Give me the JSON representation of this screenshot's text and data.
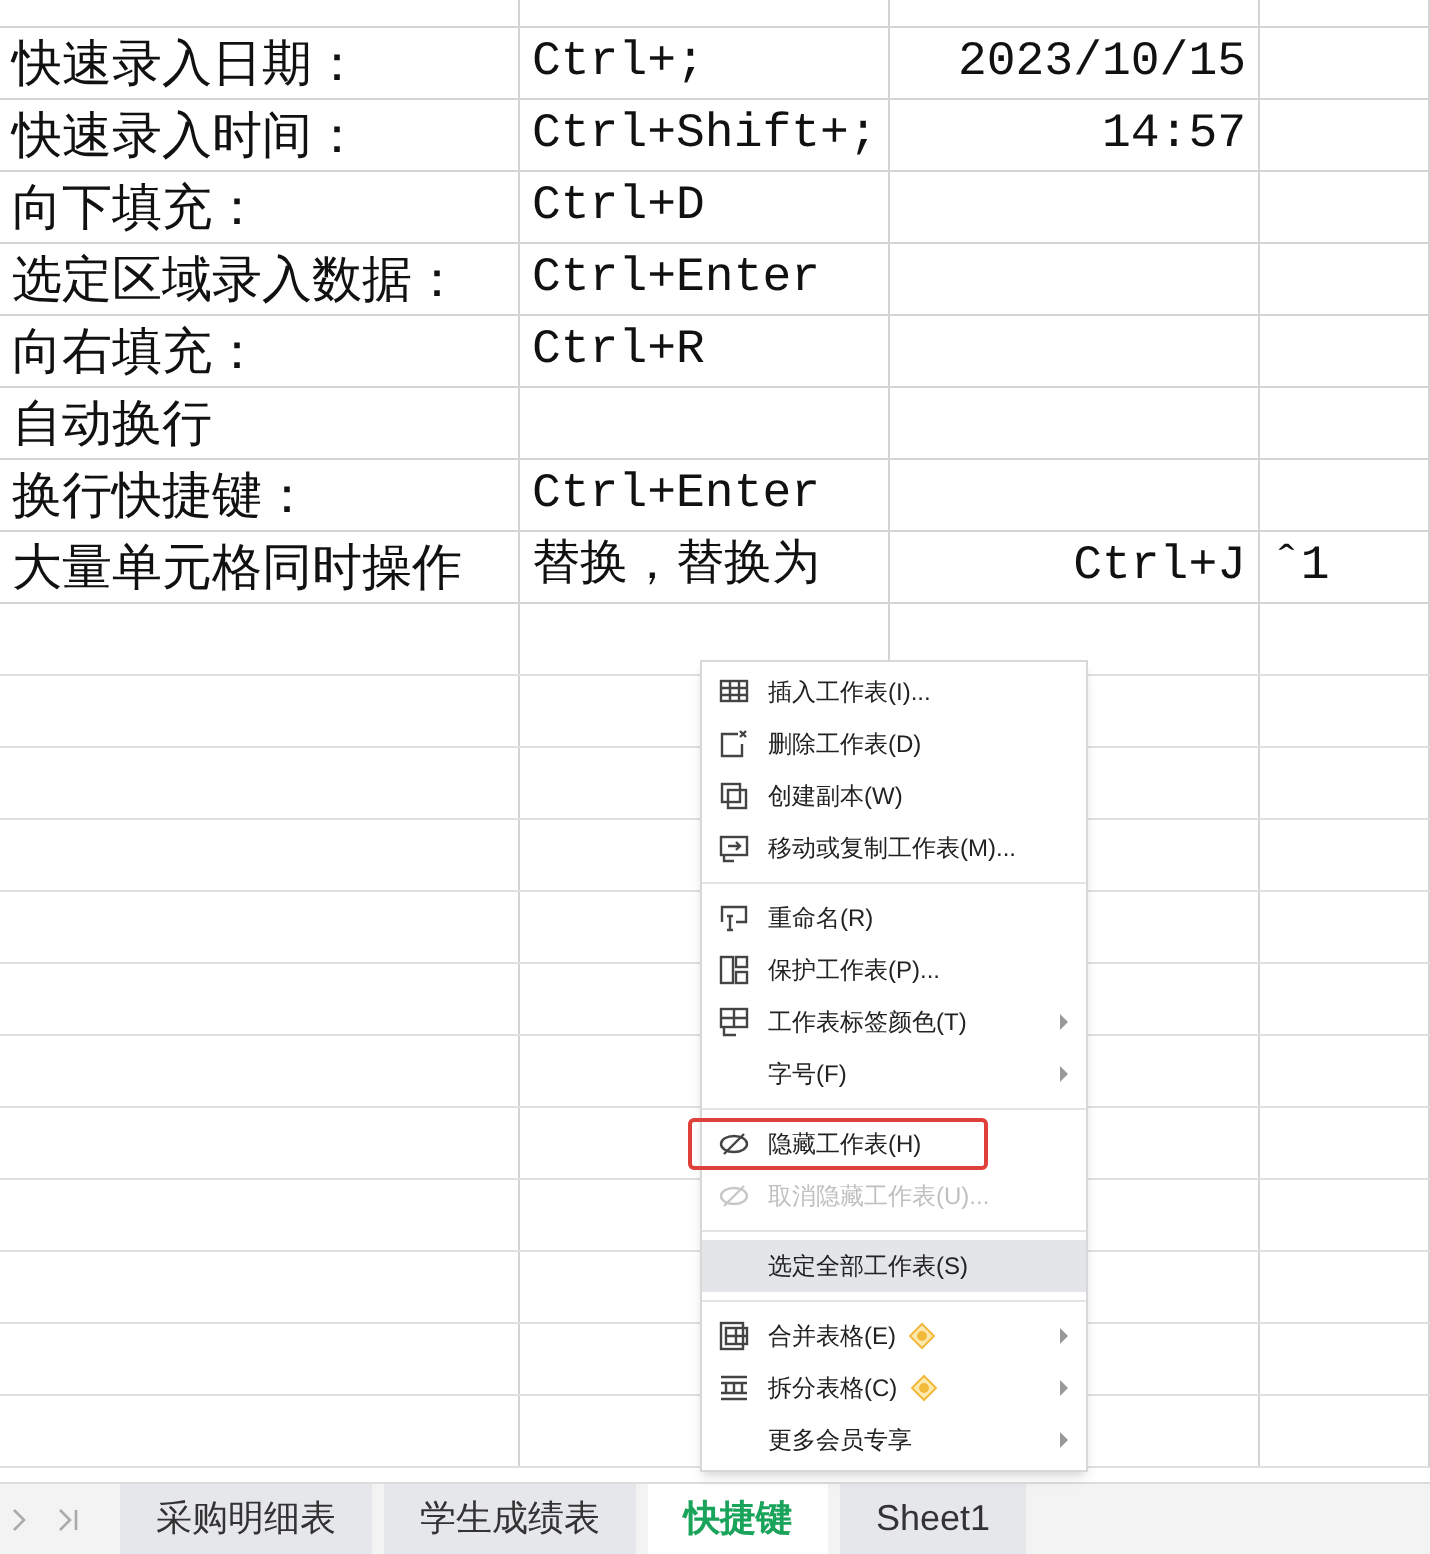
{
  "sheet": {
    "rows": [
      {
        "cells": [
          "快速录入日期：",
          "Ctrl+;",
          "2023/10/15",
          ""
        ]
      },
      {
        "cells": [
          "快速录入时间：",
          "Ctrl+Shift+;",
          "14:57",
          ""
        ]
      },
      {
        "cells": [
          "向下填充：",
          "Ctrl+D",
          "",
          ""
        ]
      },
      {
        "cells": [
          "选定区域录入数据：",
          "Ctrl+Enter",
          "",
          ""
        ]
      },
      {
        "cells": [
          "向右填充：",
          "Ctrl+R",
          "",
          ""
        ]
      },
      {
        "cells": [
          "自动换行",
          "",
          "",
          ""
        ]
      },
      {
        "cells": [
          "换行快捷键：",
          "Ctrl+Enter",
          "",
          ""
        ]
      },
      {
        "cells": [
          "大量单元格同时操作",
          "替换，替换为",
          "Ctrl+J",
          "ˆ1"
        ]
      }
    ]
  },
  "context_menu": {
    "items": [
      {
        "kind": "item",
        "label": "插入工作表(I)...",
        "disabled": false,
        "submenu": false,
        "premium": false,
        "highlighted": false,
        "outlined": false
      },
      {
        "kind": "item",
        "label": "删除工作表(D)",
        "disabled": false,
        "submenu": false,
        "premium": false,
        "highlighted": false,
        "outlined": false
      },
      {
        "kind": "item",
        "label": "创建副本(W)",
        "disabled": false,
        "submenu": false,
        "premium": false,
        "highlighted": false,
        "outlined": false
      },
      {
        "kind": "item",
        "label": "移动或复制工作表(M)...",
        "disabled": false,
        "submenu": false,
        "premium": false,
        "highlighted": false,
        "outlined": false
      },
      {
        "kind": "separator"
      },
      {
        "kind": "item",
        "label": "重命名(R)",
        "disabled": false,
        "submenu": false,
        "premium": false,
        "highlighted": false,
        "outlined": false
      },
      {
        "kind": "item",
        "label": "保护工作表(P)...",
        "disabled": false,
        "submenu": false,
        "premium": false,
        "highlighted": false,
        "outlined": false
      },
      {
        "kind": "item",
        "label": "工作表标签颜色(T)",
        "disabled": false,
        "submenu": true,
        "premium": false,
        "highlighted": false,
        "outlined": false
      },
      {
        "kind": "item",
        "label": "字号(F)",
        "disabled": false,
        "submenu": true,
        "premium": false,
        "highlighted": false,
        "outlined": false
      },
      {
        "kind": "separator"
      },
      {
        "kind": "item",
        "label": "隐藏工作表(H)",
        "disabled": false,
        "submenu": false,
        "premium": false,
        "highlighted": false,
        "outlined": true
      },
      {
        "kind": "item",
        "label": "取消隐藏工作表(U)...",
        "disabled": true,
        "submenu": false,
        "premium": false,
        "highlighted": false,
        "outlined": false
      },
      {
        "kind": "separator"
      },
      {
        "kind": "item",
        "label": "选定全部工作表(S)",
        "disabled": false,
        "submenu": false,
        "premium": false,
        "highlighted": true,
        "outlined": false
      },
      {
        "kind": "separator"
      },
      {
        "kind": "item",
        "label": "合并表格(E)",
        "disabled": false,
        "submenu": true,
        "premium": true,
        "highlighted": false,
        "outlined": false
      },
      {
        "kind": "item",
        "label": "拆分表格(C)",
        "disabled": false,
        "submenu": true,
        "premium": true,
        "highlighted": false,
        "outlined": false
      },
      {
        "kind": "item",
        "label": "更多会员专享",
        "disabled": false,
        "submenu": true,
        "premium": false,
        "highlighted": false,
        "outlined": false
      }
    ]
  },
  "sheet_tabs": [
    {
      "label": "采购明细表",
      "selected": false
    },
    {
      "label": "学生成绩表",
      "selected": false
    },
    {
      "label": "快捷键",
      "selected": true
    },
    {
      "label": "Sheet1",
      "selected": false
    }
  ]
}
